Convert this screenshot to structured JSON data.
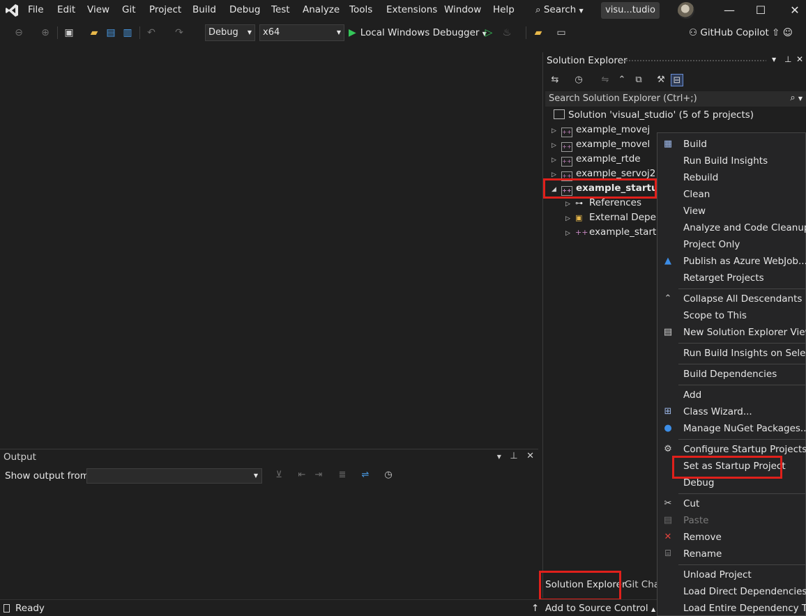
{
  "menubar": {
    "items": [
      "File",
      "Edit",
      "View",
      "Git",
      "Project",
      "Build",
      "Debug",
      "Test",
      "Analyze",
      "Tools",
      "Extensions",
      "Window",
      "Help"
    ],
    "search": "Search",
    "solution_title": "visu...tudio"
  },
  "toolbar": {
    "config": "Debug",
    "platform": "x64",
    "run_label": "Local Windows Debugger",
    "copilot": "GitHub Copilot"
  },
  "output": {
    "title": "Output",
    "show_from": "Show output from:"
  },
  "solution_explorer": {
    "title": "Solution Explorer",
    "search_placeholder": "Search Solution Explorer (Ctrl+;)",
    "solution": "Solution 'visual_studio' (5 of 5 projects)",
    "projects": [
      "example_movej",
      "example_movel",
      "example_rtde",
      "example_servoj2",
      "example_startup"
    ],
    "children": [
      "References",
      "External Depen",
      "example_startu"
    ],
    "tabs": [
      "Solution Explorer",
      "Git Char"
    ]
  },
  "context_menu": {
    "items": [
      {
        "label": "Build",
        "icon": "build-icon"
      },
      {
        "label": "Run Build Insights",
        "icon": ""
      },
      {
        "label": "Rebuild",
        "icon": ""
      },
      {
        "label": "Clean",
        "icon": ""
      },
      {
        "label": "View",
        "icon": ""
      },
      {
        "label": "Analyze and Code Cleanup",
        "icon": ""
      },
      {
        "label": "Project Only",
        "icon": ""
      },
      {
        "label": "Publish as Azure WebJob...",
        "icon": "azure-icon"
      },
      {
        "label": "Retarget Projects",
        "icon": ""
      },
      {
        "label": "Collapse All Descendants",
        "icon": "collapse-icon"
      },
      {
        "label": "Scope to This",
        "icon": ""
      },
      {
        "label": "New Solution Explorer View",
        "icon": "new-view-icon"
      },
      {
        "label": "Run Build Insights on Selected",
        "icon": ""
      },
      {
        "label": "Build Dependencies",
        "icon": ""
      },
      {
        "label": "Add",
        "icon": ""
      },
      {
        "label": "Class Wizard...",
        "icon": "class-wizard-icon"
      },
      {
        "label": "Manage NuGet Packages...",
        "icon": "nuget-icon"
      },
      {
        "label": "Configure Startup Projects...",
        "icon": "gear-icon"
      },
      {
        "label": "Set as Startup Project",
        "icon": ""
      },
      {
        "label": "Debug",
        "icon": ""
      },
      {
        "label": "Cut",
        "icon": "cut-icon"
      },
      {
        "label": "Paste",
        "icon": "paste-icon"
      },
      {
        "label": "Remove",
        "icon": "remove-icon"
      },
      {
        "label": "Rename",
        "icon": "rename-icon"
      },
      {
        "label": "Unload Project",
        "icon": ""
      },
      {
        "label": "Load Direct Dependencies",
        "icon": ""
      },
      {
        "label": "Load Entire Dependency Tree",
        "icon": ""
      }
    ]
  },
  "status": {
    "ready": "Ready",
    "source_control": "Add to Source Control"
  },
  "colors": {
    "highlight_box": "#e0201b",
    "background": "#1f1f1f",
    "menu_background": "#252526",
    "run_green": "#34c759"
  }
}
